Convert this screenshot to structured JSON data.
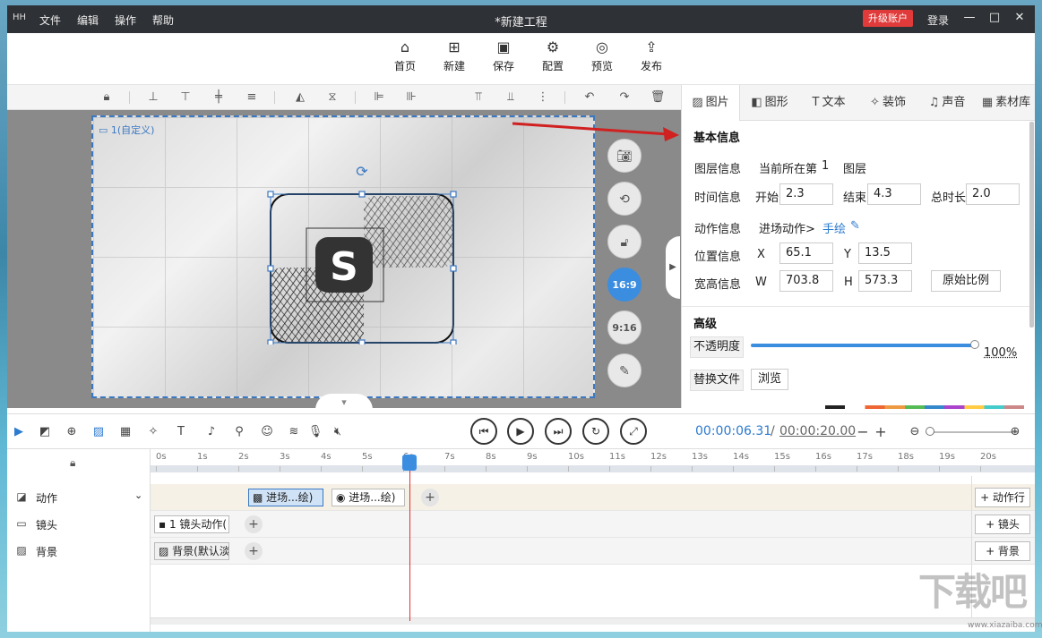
{
  "app": {
    "logo": "HH",
    "title": "*新建工程",
    "menu": [
      "文件",
      "编辑",
      "操作",
      "帮助"
    ],
    "upgrade": "升级账户",
    "login": "登录"
  },
  "toolbar": {
    "home": "首页",
    "new": "新建",
    "save": "保存",
    "config": "配置",
    "preview": "预览",
    "publish": "发布"
  },
  "canvas": {
    "camera_label": "1(自定义)",
    "logo_letter": "S",
    "ratio_169": "16:9",
    "ratio_916": "9:16"
  },
  "panel": {
    "tabs": [
      "图片",
      "图形",
      "文本",
      "装饰",
      "声音",
      "素材库"
    ],
    "basic_title": "基本信息",
    "layer_label": "图层信息",
    "layer_prefix": "当前所在第",
    "layer_num": "1",
    "layer_suffix": "图层",
    "time_label": "时间信息",
    "start_label": "开始",
    "start_val": "2.3",
    "end_label": "结束",
    "end_val": "4.3",
    "total_label": "总时长",
    "total_val": "2.0",
    "action_label": "动作信息",
    "action_val": "进场动作>",
    "action_link": "手绘",
    "pos_label": "位置信息",
    "x_label": "X",
    "x_val": "65.1",
    "y_label": "Y",
    "y_val": "13.5",
    "size_label": "宽高信息",
    "w_label": "W",
    "w_val": "703.8",
    "h_label": "H",
    "h_val": "573.3",
    "orig_ratio": "原始比例",
    "adv_title": "高级",
    "opacity_label": "不透明度",
    "opacity_val": "100%",
    "opacity_level": 1.0,
    "replace_label": "替换文件",
    "browse": "浏览"
  },
  "timeline": {
    "current_time": "00:00:06.31",
    "slash": "/",
    "total_time": "00:00:20.00",
    "ticks": [
      "0s",
      "1s",
      "2s",
      "3s",
      "4s",
      "5s",
      "6s",
      "7s",
      "8s",
      "9s",
      "10s",
      "11s",
      "12s",
      "13s",
      "14s",
      "15s",
      "16s",
      "17s",
      "18s",
      "19s",
      "20s"
    ],
    "rows": {
      "action": "动作",
      "camera": "镜头",
      "background": "背景"
    },
    "clips": {
      "action1": "进场...绘)",
      "action2": "进场...绘)",
      "camera1": "1 镜头动作(",
      "bg1": "背景(默认淡"
    },
    "add": {
      "action": "+ 动作行",
      "camera": "+ 镜头",
      "background": "+ 背景"
    }
  },
  "watermark": {
    "text": "下载吧",
    "url": "www.xiazaiba.com"
  },
  "colors": {
    "accent": "#3b8de0",
    "titlebar": "#2e3135",
    "upgrade": "#e03a3a",
    "playhead": "#e03030"
  }
}
